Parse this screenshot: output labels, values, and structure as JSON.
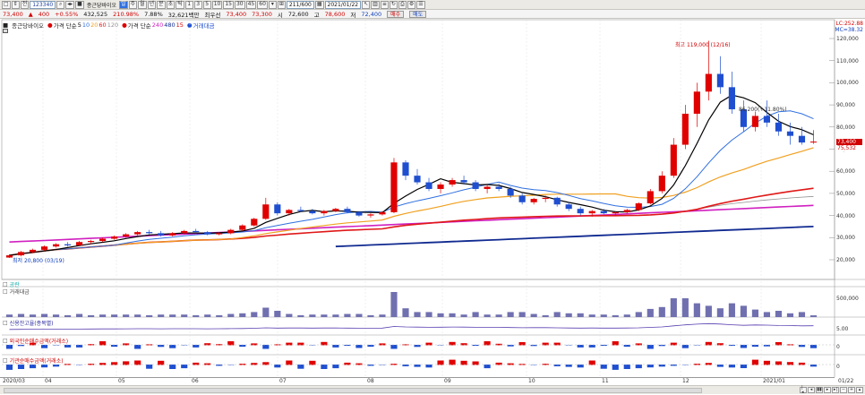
{
  "toolbar": {
    "code": "123340",
    "stock_name": "종근당바이오",
    "period_buttons": [
      "주",
      "월",
      "년",
      "분",
      "초",
      "틱"
    ],
    "minute_buttons": [
      "1",
      "3",
      "5",
      "10",
      "15",
      "30",
      "45",
      "60"
    ],
    "count_value": "211/600",
    "date_value": "2021/01/22"
  },
  "quote": {
    "price": "73,400",
    "change": "400",
    "change_pct": "+0.55%",
    "volume": "432,525",
    "vol_ratio": "210.98%",
    "turnover": "7.88%",
    "amount": "32,621백만",
    "best_ask_label": "최우선",
    "ask": "73,400",
    "bid": "73,300",
    "high_label": "시",
    "open": "72,600",
    "high_mark": "고",
    "high": "78,600",
    "low_label": "저",
    "low": "72,400",
    "buy_btn": "매수",
    "sell_btn": "매도"
  },
  "legend": {
    "name": "종근당바이오",
    "ma_label": "가격 단순",
    "ma_periods": [
      "5",
      "10",
      "20",
      "60",
      "120"
    ],
    "ma2_label": "가격 단순",
    "ma2_periods": [
      "240",
      "480",
      "15"
    ],
    "vol_label": "거래대금"
  },
  "top_right": {
    "lc": "LC:252.88",
    "mc": "MC=38.32"
  },
  "annotations": {
    "high": "최고 119,000 (12/16)",
    "low": "최저 20,800 (03/19)",
    "mid": "86,200(+11.80%)"
  },
  "y_axis": [
    "120,000",
    "110,000",
    "100,000",
    "90,000",
    "80,000",
    "70,000",
    "60,000",
    "50,000",
    "40,000",
    "30,000",
    "20,000"
  ],
  "price_tag": "73,400",
  "price_tag2": "75,532",
  "panels": {
    "blank": "공란",
    "volume": "거래대금",
    "volume_axis": "500,000",
    "credit": "신용잔고율(종목별)",
    "credit_axis": "5.00",
    "foreign": "외국인순매수금액(거래소)",
    "foreign_axis": "0",
    "inst": "기관순매수금액(거래소)",
    "inst_axis": "0"
  },
  "x_axis": [
    "2020/03",
    "04",
    "05",
    "06",
    "07",
    "08",
    "09",
    "10",
    "11",
    "12",
    "2021/01",
    "01/22"
  ],
  "colors": {
    "up": "#e00000",
    "down": "#1f4fd0",
    "ma5": "#000000",
    "ma10": "#2f6fe0",
    "ma20": "#f0a020",
    "ma60": "#e01818",
    "ma120": "#909090",
    "ma240": "#d020c0",
    "ma480": "#102a90"
  },
  "chart_data": {
    "type": "candlestick",
    "ylim": [
      15000,
      125000
    ],
    "candles": [
      [
        21000,
        22500,
        20800,
        22000
      ],
      [
        22000,
        24000,
        21500,
        23500
      ],
      [
        23500,
        25000,
        23000,
        24500
      ],
      [
        24500,
        26500,
        24000,
        26000
      ],
      [
        26000,
        27500,
        25500,
        27000
      ],
      [
        27000,
        28000,
        26000,
        26500
      ],
      [
        26500,
        28500,
        26000,
        28000
      ],
      [
        28000,
        29000,
        27000,
        28500
      ],
      [
        28500,
        30000,
        28000,
        29500
      ],
      [
        29500,
        31000,
        29000,
        30500
      ],
      [
        30500,
        32000,
        30000,
        31500
      ],
      [
        31500,
        33000,
        31000,
        32500
      ],
      [
        32500,
        33500,
        31500,
        32000
      ],
      [
        32000,
        33000,
        30500,
        31000
      ],
      [
        31000,
        32500,
        30500,
        32000
      ],
      [
        32000,
        33500,
        31500,
        33000
      ],
      [
        33000,
        34000,
        32000,
        32500
      ],
      [
        32500,
        33000,
        31000,
        31500
      ],
      [
        31500,
        32500,
        31000,
        32000
      ],
      [
        32000,
        34000,
        31500,
        33500
      ],
      [
        33500,
        36000,
        33000,
        35500
      ],
      [
        35500,
        39000,
        35000,
        38500
      ],
      [
        38500,
        48000,
        38000,
        45000
      ],
      [
        45000,
        46000,
        40000,
        41000
      ],
      [
        41000,
        43000,
        40000,
        42500
      ],
      [
        42500,
        44000,
        41500,
        42000
      ],
      [
        42000,
        43000,
        40500,
        41000
      ],
      [
        41000,
        42500,
        40000,
        42000
      ],
      [
        42000,
        43500,
        41500,
        43000
      ],
      [
        43000,
        44000,
        41000,
        41500
      ],
      [
        41500,
        42000,
        39500,
        40000
      ],
      [
        40000,
        41000,
        39000,
        40500
      ],
      [
        40500,
        42000,
        40000,
        41500
      ],
      [
        41500,
        66000,
        41000,
        64000
      ],
      [
        64000,
        65000,
        56000,
        58000
      ],
      [
        58000,
        61000,
        54000,
        55000
      ],
      [
        55000,
        57000,
        51000,
        52000
      ],
      [
        52000,
        55000,
        50000,
        54000
      ],
      [
        54000,
        57000,
        53000,
        56000
      ],
      [
        56000,
        58000,
        54000,
        55000
      ],
      [
        55000,
        56000,
        51000,
        52000
      ],
      [
        52000,
        54000,
        50000,
        53000
      ],
      [
        53000,
        54500,
        51000,
        52000
      ],
      [
        52000,
        53000,
        48000,
        49000
      ],
      [
        49000,
        50000,
        45000,
        46000
      ],
      [
        46000,
        48000,
        45000,
        47500
      ],
      [
        47500,
        49000,
        46000,
        48000
      ],
      [
        48000,
        48500,
        44000,
        45000
      ],
      [
        45000,
        46000,
        42000,
        43000
      ],
      [
        43000,
        44000,
        40000,
        41000
      ],
      [
        41000,
        42500,
        39500,
        42000
      ],
      [
        42000,
        43000,
        40500,
        41000
      ],
      [
        41000,
        42000,
        40000,
        41500
      ],
      [
        41500,
        43000,
        41000,
        42500
      ],
      [
        42500,
        46000,
        42000,
        45500
      ],
      [
        45500,
        52000,
        45000,
        51000
      ],
      [
        51000,
        60000,
        50000,
        58000
      ],
      [
        58000,
        75000,
        57000,
        72000
      ],
      [
        72000,
        90000,
        70000,
        86000
      ],
      [
        86000,
        100000,
        80000,
        96000
      ],
      [
        96000,
        119000,
        92000,
        104000
      ],
      [
        104000,
        112000,
        95000,
        98000
      ],
      [
        98000,
        105000,
        86000,
        88000
      ],
      [
        88000,
        92000,
        78000,
        80000
      ],
      [
        80000,
        87000,
        78000,
        85000
      ],
      [
        85000,
        92000,
        80000,
        82000
      ],
      [
        82000,
        86000,
        76000,
        78000
      ],
      [
        78000,
        82000,
        72000,
        76000
      ],
      [
        76000,
        80000,
        72000,
        73000
      ],
      [
        73000,
        78600,
        72400,
        73400
      ]
    ],
    "volume_note": "bars rendered from candle changes"
  }
}
